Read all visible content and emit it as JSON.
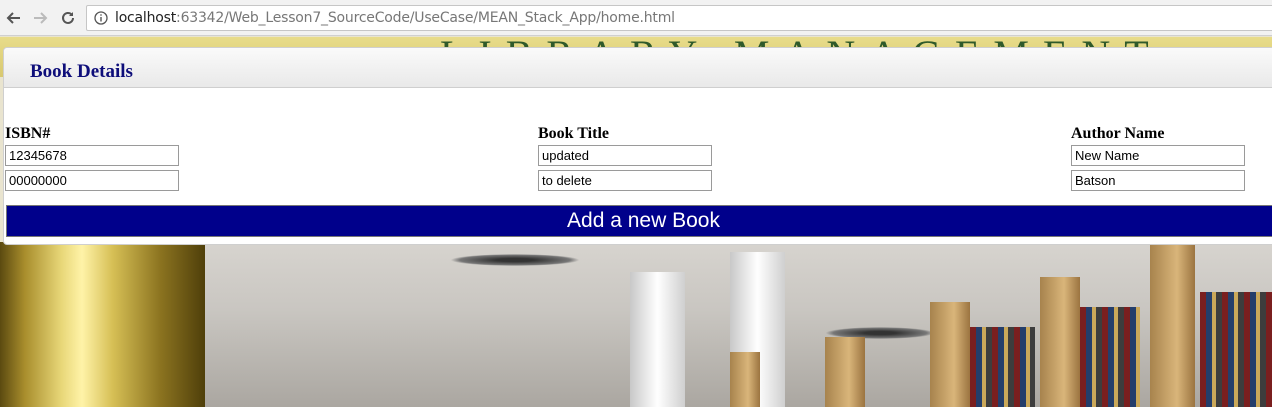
{
  "browser": {
    "url_host": "localhost",
    "url_rest": ":63342/Web_Lesson7_SourceCode/UseCase/MEAN_Stack_App/home.html"
  },
  "banner": {
    "text": "LIBRARY MANAGEMENT"
  },
  "panel": {
    "title": "Book Details",
    "columns": [
      "ISBN#",
      "Book Title",
      "Author Name"
    ],
    "rows": [
      {
        "isbn": "12345678",
        "title": "updated",
        "author": "New Name"
      },
      {
        "isbn": "00000000",
        "title": "to delete",
        "author": "Batson"
      }
    ],
    "add_label": "Add a new Book"
  }
}
